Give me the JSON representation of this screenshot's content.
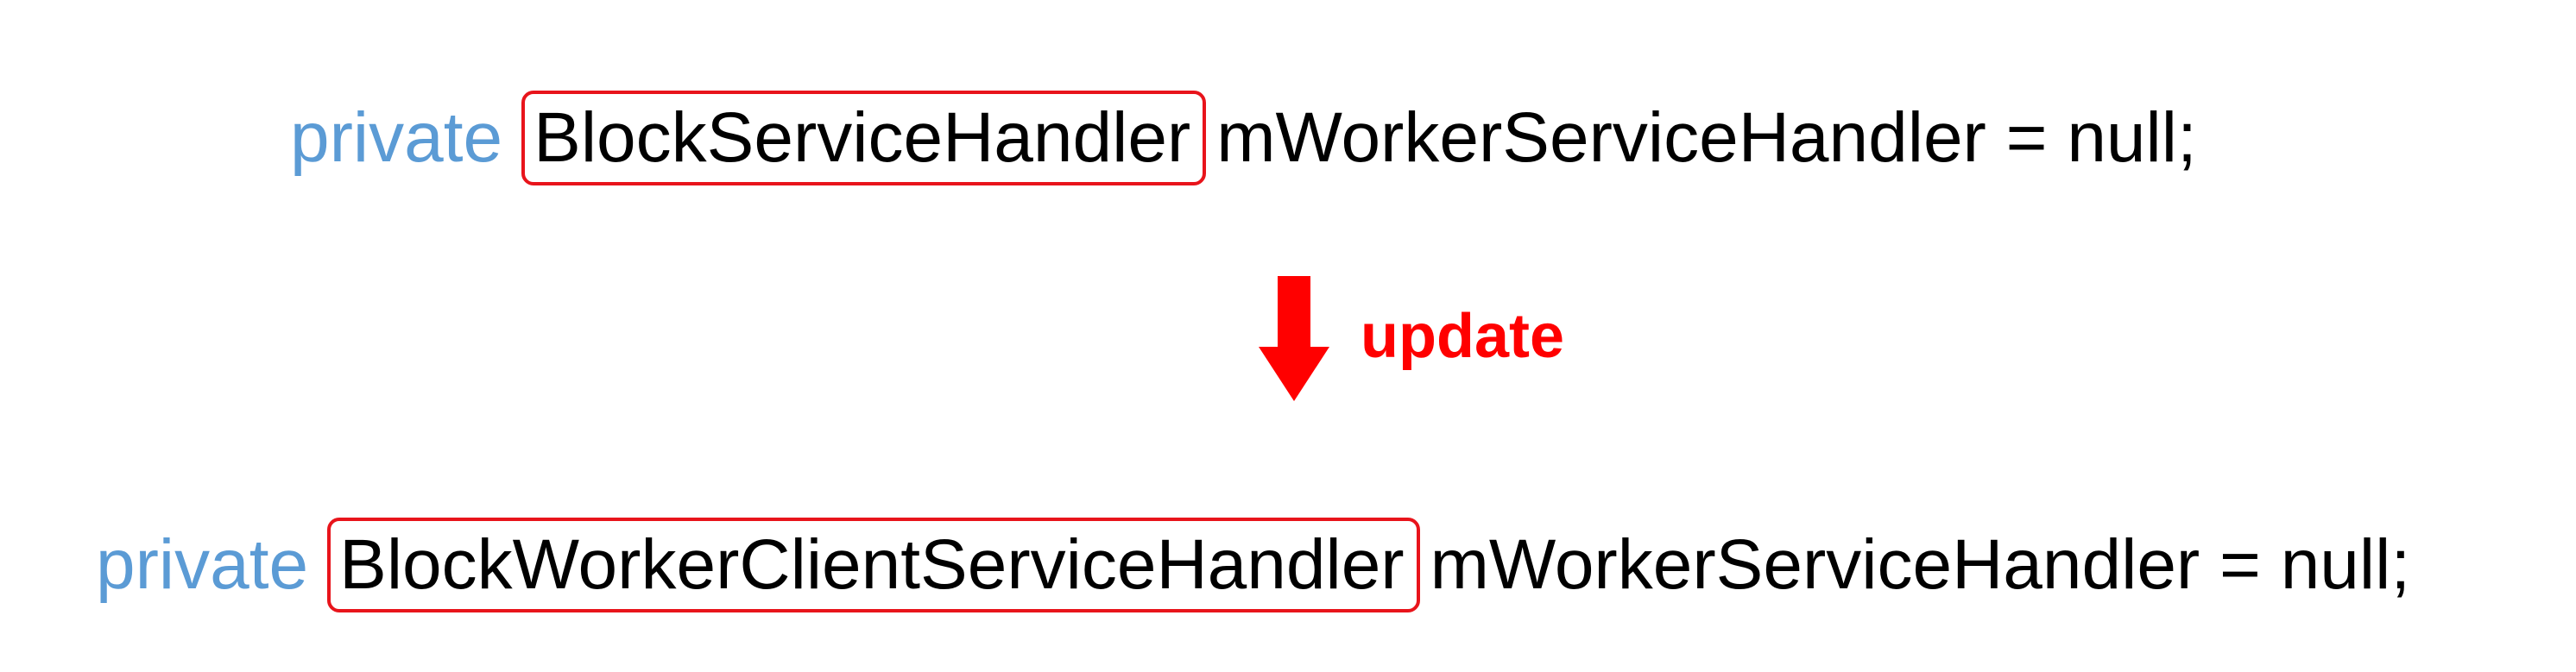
{
  "before": {
    "keyword": "private",
    "type": "BlockServiceHandler",
    "rest": "mWorkerServiceHandler = null;"
  },
  "change": {
    "label": "update",
    "icon": "arrow-down-icon"
  },
  "after": {
    "keyword": "private",
    "type": "BlockWorkerClientServiceHandler",
    "rest": "mWorkerServiceHandler = null;"
  },
  "colors": {
    "keyword": "#5b9bd5",
    "highlight": "#e8141b",
    "arrow": "#ff0000",
    "text": "#000000"
  }
}
